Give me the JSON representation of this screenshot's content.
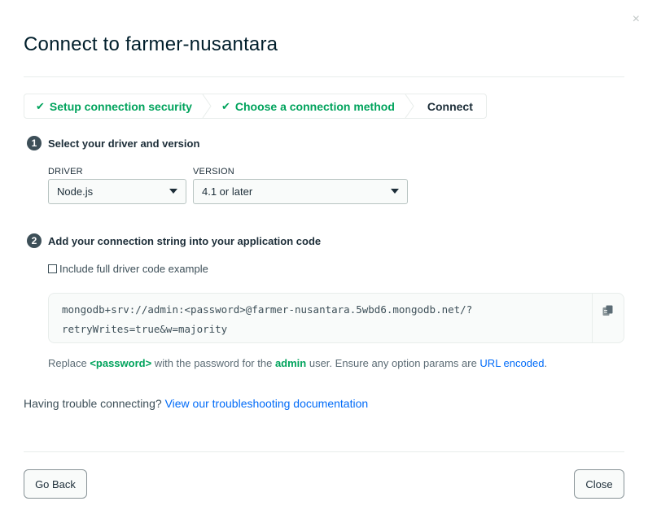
{
  "modal": {
    "title": "Connect to farmer-nusantara",
    "close_symbol": "×"
  },
  "stepper": {
    "steps": [
      {
        "label": "Setup connection security",
        "state": "done",
        "icon": "check-icon"
      },
      {
        "label": "Choose a connection method",
        "state": "done",
        "icon": "check-icon"
      },
      {
        "label": "Connect",
        "state": "current"
      }
    ]
  },
  "section1": {
    "number": "1",
    "heading": "Select your driver and version",
    "driver_label": "DRIVER",
    "driver_value": "Node.js",
    "version_label": "VERSION",
    "version_value": "4.1 or later"
  },
  "section2": {
    "number": "2",
    "heading": "Add your connection string into your application code",
    "checkbox_label": "Include full driver code example",
    "checkbox_checked": false,
    "connection_string_line1": "mongodb+srv://admin:<password>@farmer-nusantara.5wbd6.mongodb.net/?",
    "connection_string_line2": "retryWrites=true&w=majority",
    "copy_icon": "copy-icon"
  },
  "note": {
    "prefix": "Replace ",
    "password_token": "<password>",
    "middle": " with the password for the ",
    "user": "admin",
    "suffix": " user. Ensure any option params are ",
    "link": "URL encoded",
    "end": "."
  },
  "trouble": {
    "text": "Having trouble connecting? ",
    "link": "View our troubleshooting documentation"
  },
  "footer": {
    "back_label": "Go Back",
    "close_label": "Close"
  },
  "colors": {
    "success_green": "#00a35c",
    "link_blue": "#016bf8",
    "text_dark": "#1c2d38"
  }
}
